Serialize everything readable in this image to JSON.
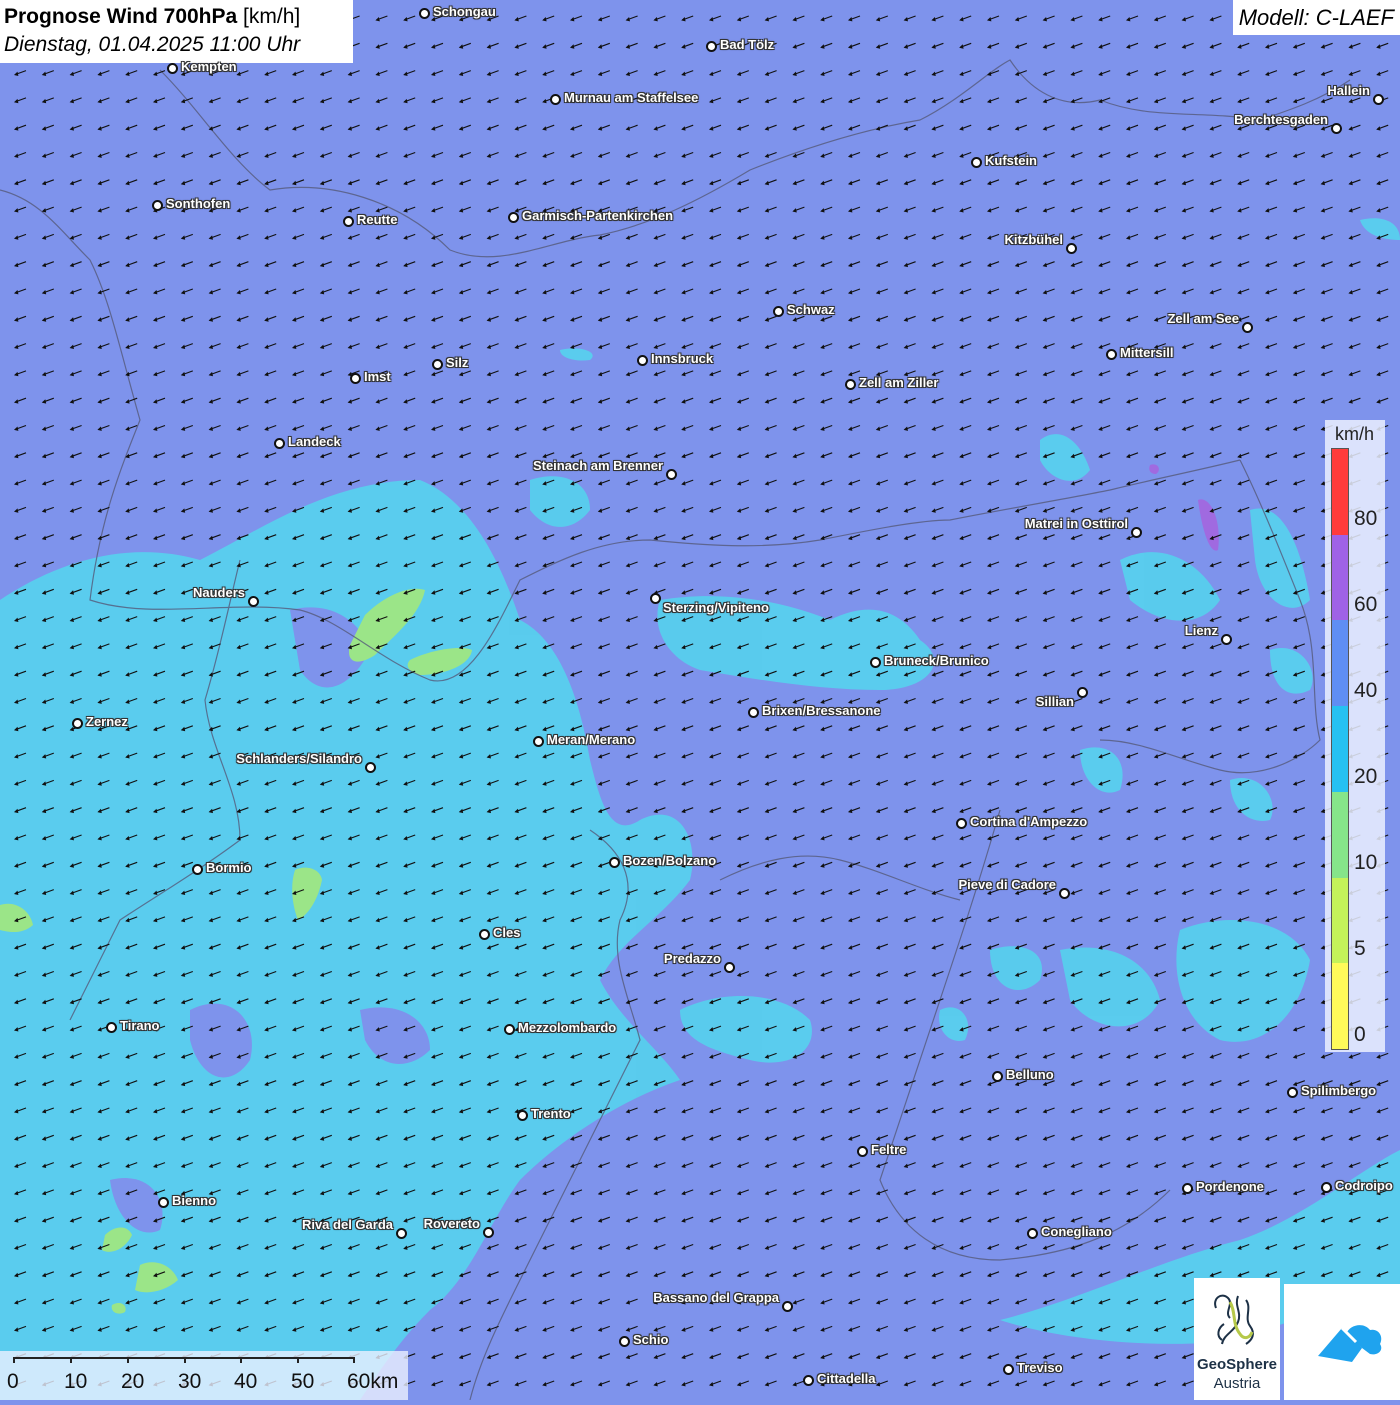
{
  "header": {
    "title_bold": "Prognose Wind 700hPa",
    "title_unit": "[km/h]",
    "subtitle": "Dienstag, 01.04.2025 11:00 Uhr"
  },
  "model_label": "Modell: C-LAEF",
  "wind": {
    "direction_arrow": "south-west",
    "field_colors": {
      "background": "#7e93ec",
      "light_blue": "#58cfee",
      "green": "#9be588",
      "purple": "#a06ae0"
    }
  },
  "legend": {
    "unit": "km/h",
    "labels": [
      "80",
      "60",
      "40",
      "20",
      "10",
      "5",
      "0"
    ],
    "colors": [
      "#ff3b3b",
      "#9f62e6",
      "#5f8ef4",
      "#26c1f2",
      "#86e58a",
      "#c4f25a",
      "#fffa5a"
    ]
  },
  "cities": [
    {
      "name": "Schongau"
    },
    {
      "name": "Bad Tölz"
    },
    {
      "name": "Kempten"
    },
    {
      "name": "Murnau am Staffelsee"
    },
    {
      "name": "Hallein"
    },
    {
      "name": "Berchtesgaden"
    },
    {
      "name": "Kufstein"
    },
    {
      "name": "Sonthofen"
    },
    {
      "name": "Reutte"
    },
    {
      "name": "Garmisch-Partenkirchen"
    },
    {
      "name": "Kitzbühel"
    },
    {
      "name": "Schwaz"
    },
    {
      "name": "Zell am See"
    },
    {
      "name": "Mittersill"
    },
    {
      "name": "Innsbruck"
    },
    {
      "name": "Silz"
    },
    {
      "name": "Imst"
    },
    {
      "name": "Zell am Ziller"
    },
    {
      "name": "Landeck"
    },
    {
      "name": "Steinach am Brenner"
    },
    {
      "name": "Matrei in Osttirol"
    },
    {
      "name": "Nauders"
    },
    {
      "name": "Sterzing/Vipiteno"
    },
    {
      "name": "Lienz"
    },
    {
      "name": "Bruneck/Brunico"
    },
    {
      "name": "Sillian"
    },
    {
      "name": "Brixen/Bressanone"
    },
    {
      "name": "Zernez"
    },
    {
      "name": "Meran/Merano"
    },
    {
      "name": "Schlanders/Silandro"
    },
    {
      "name": "Cortina d'Ampezzo"
    },
    {
      "name": "Bozen/Bolzano"
    },
    {
      "name": "Bormio"
    },
    {
      "name": "Pieve di Cadore"
    },
    {
      "name": "Cles"
    },
    {
      "name": "Predazzo"
    },
    {
      "name": "Tirano"
    },
    {
      "name": "Mezzolombardo"
    },
    {
      "name": "Belluno"
    },
    {
      "name": "Spilimbergo"
    },
    {
      "name": "Trento"
    },
    {
      "name": "Feltre"
    },
    {
      "name": "Bienno"
    },
    {
      "name": "Pordenone"
    },
    {
      "name": "Codroipo"
    },
    {
      "name": "Riva del Garda"
    },
    {
      "name": "Rovereto"
    },
    {
      "name": "Conegliano"
    },
    {
      "name": "Bassano del Grappa"
    },
    {
      "name": "Schio"
    },
    {
      "name": "Treviso"
    },
    {
      "name": "Cittadella"
    }
  ],
  "scalebar": {
    "labels": [
      "0",
      "10",
      "20",
      "30",
      "40",
      "50",
      "60km"
    ]
  },
  "logos": {
    "geosphere_line1": "GeoSphere",
    "geosphere_line2": "Austria"
  }
}
